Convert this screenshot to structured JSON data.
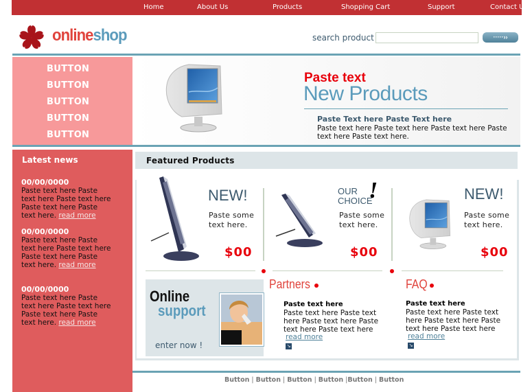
{
  "nav": {
    "items": [
      "Home",
      "About Us",
      "Products",
      "Shopping Cart",
      "Support",
      "Contact Us"
    ]
  },
  "header": {
    "logo_part1": "online",
    "logo_part2": "shop",
    "search_label": "search product",
    "search_value": "",
    "search_button": "·····››",
    "logo_icon": "flower-icon"
  },
  "banner": {
    "buttons": [
      "BUTTON",
      "BUTTON",
      "BUTTON",
      "BUTTON",
      "BUTTON"
    ],
    "red_title": "Paste text",
    "big_title": "New Products",
    "subtitle": "Paste Text here Paste Text here",
    "body": "Paste text here Paste text here Paste text here Paste text here Paste text here.",
    "image": "crt-monitor-image"
  },
  "sidebar": {
    "title": "Latest news",
    "news": [
      {
        "date": "00/00/0000",
        "text": "Paste text here Paste text here Paste text here Paste text here Paste text here.",
        "link": "read more"
      },
      {
        "date": "00/00/0000",
        "text": "Paste text here Paste text here Paste text here Paste text here Paste text here.",
        "link": "read more"
      },
      {
        "date": "00/00/0000",
        "text": "Paste text here Paste text here Paste text here Paste text here Paste text here.",
        "link": "read more"
      }
    ]
  },
  "featured": {
    "title": "Featured Products",
    "products": [
      {
        "badge": "NEW!",
        "desc": "Paste some text here.",
        "price": "$00",
        "image": "lcd-monitor-image"
      },
      {
        "badge_line1": "OUR",
        "badge_line2": "CHOICE",
        "badge_mark": "!",
        "desc": "Paste some text here.",
        "price": "$00",
        "image": "lcd-monitor-image"
      },
      {
        "badge": "NEW!",
        "desc": "Paste some text here.",
        "price": "$00",
        "image": "crt-monitor-image"
      }
    ]
  },
  "support": {
    "line1": "Online",
    "line2": "support",
    "cta": "enter now !",
    "image": "support-agent-photo"
  },
  "partners": {
    "title": "Partners",
    "bold": "Paste text here",
    "body": "Paste text here Paste text here Paste text here Paste text here Paste text here",
    "link": "read more"
  },
  "faq": {
    "title": "FAQ",
    "bold": "Paste text here",
    "body": "Paste text here Paste text here Paste text here Paste text here Paste text here",
    "link": "read more"
  },
  "footer": {
    "links": [
      "Button",
      "Button",
      "Button",
      "Button",
      "Button",
      "Button"
    ]
  },
  "colors": {
    "nav_red": "#c13033",
    "sidebar_red": "#df5c5d",
    "pink_panel": "#f7999a",
    "accent_blue": "#5b9bbb",
    "price_red": "#e8000b",
    "rule_teal": "#6aa3b4"
  }
}
